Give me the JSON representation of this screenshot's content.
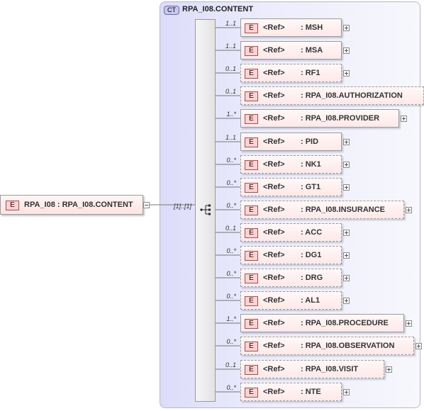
{
  "complex_type": {
    "badge": "CT",
    "name": "RPA_I08.CONTENT"
  },
  "root": {
    "badge": "E",
    "label": "RPA_I08 : RPA_I08.CONTENT",
    "multiplicity": "[1]..[1]"
  },
  "children": [
    {
      "badge": "E",
      "ref": "<Ref>",
      "name": ": MSH",
      "multiplicity": "1..1",
      "optional": false
    },
    {
      "badge": "E",
      "ref": "<Ref>",
      "name": ": MSA",
      "multiplicity": "1..1",
      "optional": false
    },
    {
      "badge": "E",
      "ref": "<Ref>",
      "name": ": RF1",
      "multiplicity": "0..1",
      "optional": true
    },
    {
      "badge": "E",
      "ref": "<Ref>",
      "name": ": RPA_I08.AUTHORIZATION",
      "multiplicity": "0..1",
      "optional": true
    },
    {
      "badge": "E",
      "ref": "<Ref>",
      "name": ": RPA_I08.PROVIDER",
      "multiplicity": "1..*",
      "optional": false
    },
    {
      "badge": "E",
      "ref": "<Ref>",
      "name": ": PID",
      "multiplicity": "1..1",
      "optional": false
    },
    {
      "badge": "E",
      "ref": "<Ref>",
      "name": ": NK1",
      "multiplicity": "0..*",
      "optional": true
    },
    {
      "badge": "E",
      "ref": "<Ref>",
      "name": ": GT1",
      "multiplicity": "0..*",
      "optional": true
    },
    {
      "badge": "E",
      "ref": "<Ref>",
      "name": ": RPA_I08.INSURANCE",
      "multiplicity": "0..*",
      "optional": true
    },
    {
      "badge": "E",
      "ref": "<Ref>",
      "name": ": ACC",
      "multiplicity": "0..1",
      "optional": true
    },
    {
      "badge": "E",
      "ref": "<Ref>",
      "name": ": DG1",
      "multiplicity": "0..*",
      "optional": true
    },
    {
      "badge": "E",
      "ref": "<Ref>",
      "name": ": DRG",
      "multiplicity": "0..*",
      "optional": true
    },
    {
      "badge": "E",
      "ref": "<Ref>",
      "name": ": AL1",
      "multiplicity": "0..*",
      "optional": true
    },
    {
      "badge": "E",
      "ref": "<Ref>",
      "name": ": RPA_I08.PROCEDURE",
      "multiplicity": "1..*",
      "optional": false
    },
    {
      "badge": "E",
      "ref": "<Ref>",
      "name": ": RPA_I08.OBSERVATION",
      "multiplicity": "0..*",
      "optional": true
    },
    {
      "badge": "E",
      "ref": "<Ref>",
      "name": ": RPA_I08.VISIT",
      "multiplicity": "0..1",
      "optional": true
    },
    {
      "badge": "E",
      "ref": "<Ref>",
      "name": ": NTE",
      "multiplicity": "0..*",
      "optional": true
    }
  ]
}
